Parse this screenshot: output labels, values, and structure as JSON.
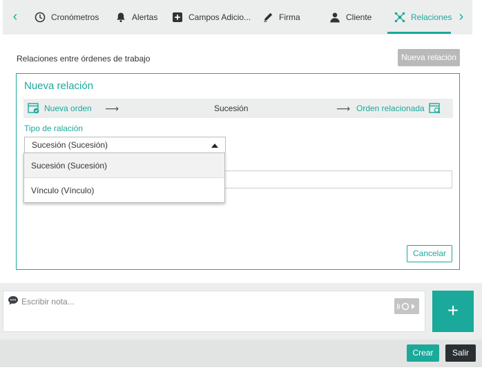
{
  "tabs": [
    {
      "label": "Cronómetros",
      "icon": "clock-icon"
    },
    {
      "label": "Alertas",
      "icon": "bell-icon"
    },
    {
      "label": "Campos Adicio...",
      "icon": "plus-square-icon"
    },
    {
      "label": "Firma",
      "icon": "pen-icon"
    },
    {
      "label": "Cliente",
      "icon": "user-icon"
    },
    {
      "label": "Relaciones",
      "icon": "network-icon",
      "active": true
    }
  ],
  "nav": {
    "prev_icon": "chevron-left-icon",
    "next_icon": "chevron-right-icon"
  },
  "relations": {
    "section_title": "Relaciones entre órdenes de trabajo",
    "new_button": "Nueva relación"
  },
  "card": {
    "title": "Nueva relación",
    "flow": {
      "left_label": "Nueva orden",
      "middle_label": "Sucesión",
      "right_label": "Orden relacionada"
    },
    "type_label": "Tipo de ralación",
    "selected_type": "Sucesión (Sucesión)",
    "options": [
      "Sucesión (Sucesión)",
      "Vínculo (Vínculo)"
    ],
    "cancel_button": "Cancelar"
  },
  "note": {
    "placeholder": "Escribir nota...",
    "add_label": "+"
  },
  "footer": {
    "create_button": "Crear",
    "exit_button": "Salir"
  },
  "colors": {
    "accent": "#1aa99a",
    "dark_button": "#2a2f33",
    "disabled_button": "#b9b9b9"
  }
}
